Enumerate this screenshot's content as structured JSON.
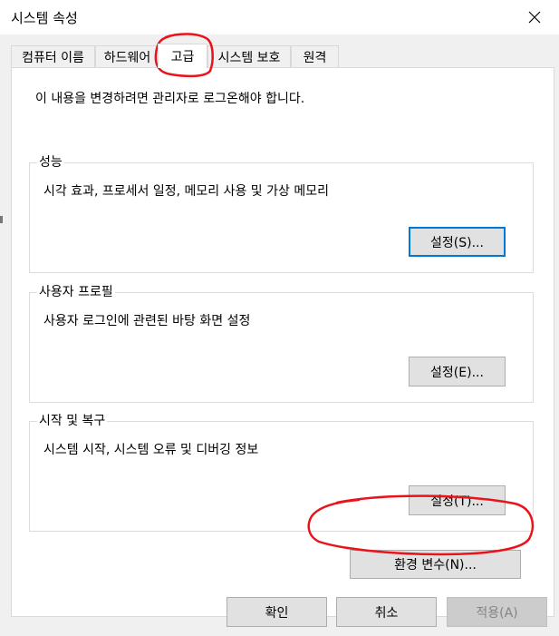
{
  "window": {
    "title": "시스템 속성",
    "close_icon": "close-icon"
  },
  "tabs": [
    {
      "label": "컴퓨터 이름"
    },
    {
      "label": "하드웨어"
    },
    {
      "label": "고급",
      "active": true
    },
    {
      "label": "시스템 보호"
    },
    {
      "label": "원격"
    }
  ],
  "panel": {
    "notice": "이 내용을 변경하려면 관리자로 로그온해야 합니다.",
    "performance": {
      "label": "성능",
      "description": "시각 효과, 프로세서 일정, 메모리 사용 및 가상 메모리",
      "button": "설정(S)..."
    },
    "user_profiles": {
      "label": "사용자 프로필",
      "description": "사용자 로그인에 관련된 바탕 화면 설정",
      "button": "설정(E)..."
    },
    "startup_recovery": {
      "label": "시작 및 복구",
      "description": "시스템 시작, 시스템 오류 및 디버깅 정보",
      "button": "설정(T)..."
    },
    "env_button": "환경 변수(N)..."
  },
  "footer": {
    "ok": "확인",
    "cancel": "취소",
    "apply": "적용(A)"
  },
  "colors": {
    "annotation_red": "#e8141c",
    "focus_blue": "#0078d7"
  }
}
